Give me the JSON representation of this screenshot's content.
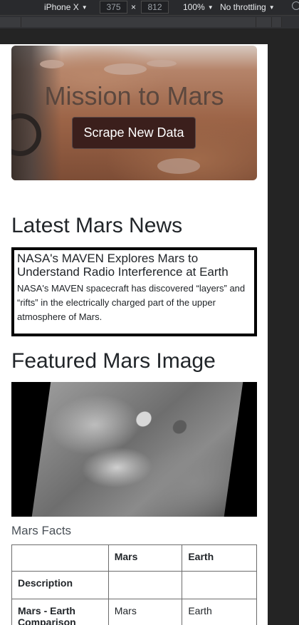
{
  "devtools": {
    "device": "iPhone X",
    "width": "375",
    "separator": "×",
    "height": "812",
    "zoom": "100%",
    "throttling": "No throttling",
    "caret": "▼"
  },
  "jumbotron": {
    "title": "Mission to Mars",
    "button_label": "Scrape New Data"
  },
  "news": {
    "section_title": "Latest Mars News",
    "headline": "NASA's MAVEN Explores Mars to Understand Radio Interference at Earth",
    "teaser": "NASA's MAVEN spacecraft has discovered “layers” and “rifts” in the electrically charged part of the upper atmosphere of Mars."
  },
  "featured_image": {
    "section_title": "Featured Mars Image"
  },
  "facts": {
    "caption": "Mars Facts",
    "columns": [
      "",
      "Mars",
      "Earth"
    ],
    "rows": [
      {
        "label": "Description",
        "mars": "",
        "earth": ""
      },
      {
        "label": "Mars - Earth Comparison",
        "mars": "Mars",
        "earth": "Earth"
      }
    ]
  }
}
